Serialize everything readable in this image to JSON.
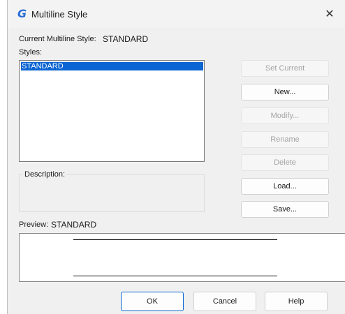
{
  "window": {
    "title": "Multiline Style",
    "app_icon": "G",
    "close_glyph": "✕"
  },
  "current_style": {
    "label": "Current Multiline Style:",
    "value": "STANDARD"
  },
  "styles": {
    "label": "Styles:",
    "items": [
      "STANDARD"
    ],
    "selected_index": 0
  },
  "description": {
    "label": "Description:"
  },
  "buttons": {
    "set_current": "Set Current",
    "new": "New...",
    "modify": "Modify...",
    "rename": "Rename",
    "delete": "Delete",
    "load": "Load...",
    "save": "Save..."
  },
  "preview": {
    "label": "Preview:",
    "style_name": "STANDARD"
  },
  "footer": {
    "ok": "OK",
    "cancel": "Cancel",
    "help": "Help"
  },
  "colors": {
    "accent": "#0a64d2",
    "app_icon": "#2a6fd6",
    "disabled_text": "#a3a3a3"
  }
}
